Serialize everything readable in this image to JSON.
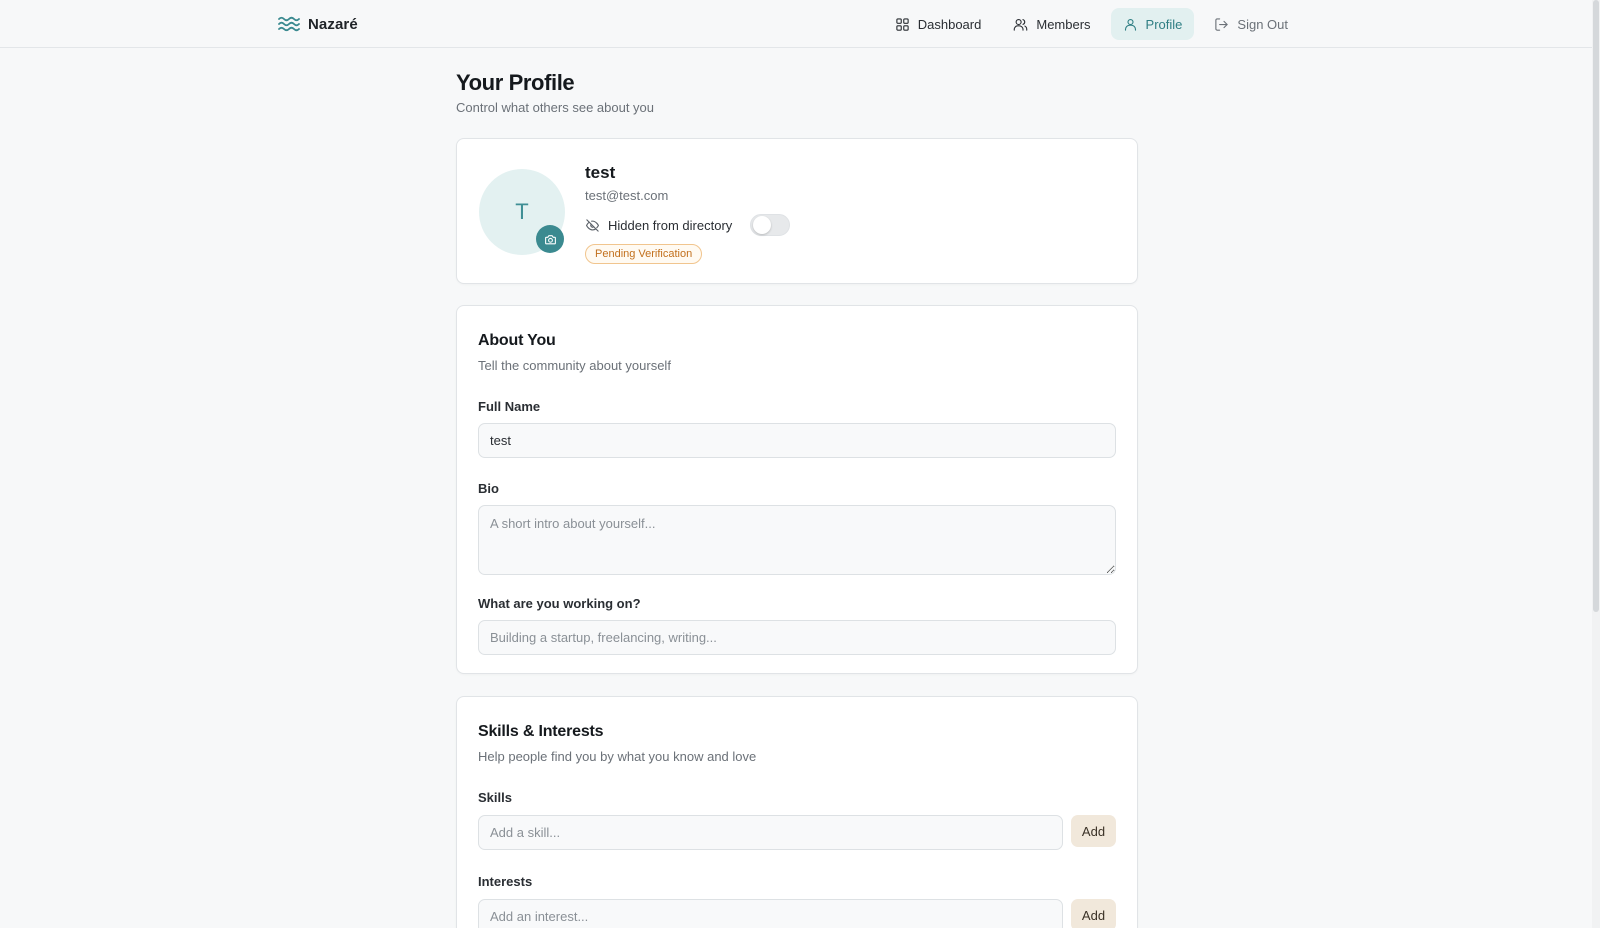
{
  "app": {
    "brand": "Nazaré",
    "brand_icon": "waves-icon",
    "accent": "#3b8a90"
  },
  "nav": {
    "items": [
      {
        "label": "Dashboard",
        "icon": "grid-icon"
      },
      {
        "label": "Members",
        "icon": "users-icon"
      },
      {
        "label": "Profile",
        "icon": "user-icon",
        "active": true
      },
      {
        "label": "Sign Out",
        "icon": "sign-out-icon"
      }
    ]
  },
  "page": {
    "title": "Your Profile",
    "subtitle": "Control what others see about you"
  },
  "profile": {
    "initial": "T",
    "name": "test",
    "email": "test@test.com",
    "visibility_label": "Hidden from directory",
    "visibility_on": false,
    "status_badge": "Pending Verification",
    "status_color": "#c2701d"
  },
  "about": {
    "title": "About You",
    "subtitle": "Tell the community about yourself",
    "full_name_label": "Full Name",
    "full_name_value": "test",
    "bio_label": "Bio",
    "bio_placeholder": "A short intro about yourself...",
    "working_on_label": "What are you working on?",
    "working_on_placeholder": "Building a startup, freelancing, writing..."
  },
  "skills": {
    "title": "Skills & Interests",
    "subtitle": "Help people find you by what you know and love",
    "skills_label": "Skills",
    "skills_placeholder": "Add a skill...",
    "interests_label": "Interests",
    "interests_placeholder": "Add an interest...",
    "add_label": "Add"
  }
}
